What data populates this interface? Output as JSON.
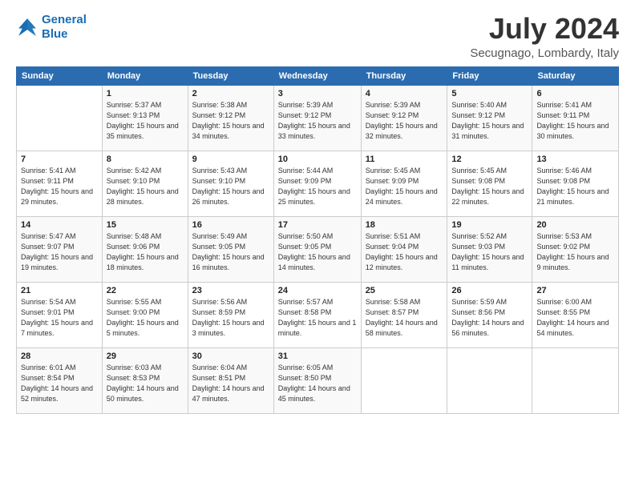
{
  "header": {
    "logo_line1": "General",
    "logo_line2": "Blue",
    "month": "July 2024",
    "location": "Secugnago, Lombardy, Italy"
  },
  "weekdays": [
    "Sunday",
    "Monday",
    "Tuesday",
    "Wednesday",
    "Thursday",
    "Friday",
    "Saturday"
  ],
  "weeks": [
    [
      {
        "day": "",
        "sunrise": "",
        "sunset": "",
        "daylight": ""
      },
      {
        "day": "1",
        "sunrise": "Sunrise: 5:37 AM",
        "sunset": "Sunset: 9:13 PM",
        "daylight": "Daylight: 15 hours and 35 minutes."
      },
      {
        "day": "2",
        "sunrise": "Sunrise: 5:38 AM",
        "sunset": "Sunset: 9:12 PM",
        "daylight": "Daylight: 15 hours and 34 minutes."
      },
      {
        "day": "3",
        "sunrise": "Sunrise: 5:39 AM",
        "sunset": "Sunset: 9:12 PM",
        "daylight": "Daylight: 15 hours and 33 minutes."
      },
      {
        "day": "4",
        "sunrise": "Sunrise: 5:39 AM",
        "sunset": "Sunset: 9:12 PM",
        "daylight": "Daylight: 15 hours and 32 minutes."
      },
      {
        "day": "5",
        "sunrise": "Sunrise: 5:40 AM",
        "sunset": "Sunset: 9:12 PM",
        "daylight": "Daylight: 15 hours and 31 minutes."
      },
      {
        "day": "6",
        "sunrise": "Sunrise: 5:41 AM",
        "sunset": "Sunset: 9:11 PM",
        "daylight": "Daylight: 15 hours and 30 minutes."
      }
    ],
    [
      {
        "day": "7",
        "sunrise": "Sunrise: 5:41 AM",
        "sunset": "Sunset: 9:11 PM",
        "daylight": "Daylight: 15 hours and 29 minutes."
      },
      {
        "day": "8",
        "sunrise": "Sunrise: 5:42 AM",
        "sunset": "Sunset: 9:10 PM",
        "daylight": "Daylight: 15 hours and 28 minutes."
      },
      {
        "day": "9",
        "sunrise": "Sunrise: 5:43 AM",
        "sunset": "Sunset: 9:10 PM",
        "daylight": "Daylight: 15 hours and 26 minutes."
      },
      {
        "day": "10",
        "sunrise": "Sunrise: 5:44 AM",
        "sunset": "Sunset: 9:09 PM",
        "daylight": "Daylight: 15 hours and 25 minutes."
      },
      {
        "day": "11",
        "sunrise": "Sunrise: 5:45 AM",
        "sunset": "Sunset: 9:09 PM",
        "daylight": "Daylight: 15 hours and 24 minutes."
      },
      {
        "day": "12",
        "sunrise": "Sunrise: 5:45 AM",
        "sunset": "Sunset: 9:08 PM",
        "daylight": "Daylight: 15 hours and 22 minutes."
      },
      {
        "day": "13",
        "sunrise": "Sunrise: 5:46 AM",
        "sunset": "Sunset: 9:08 PM",
        "daylight": "Daylight: 15 hours and 21 minutes."
      }
    ],
    [
      {
        "day": "14",
        "sunrise": "Sunrise: 5:47 AM",
        "sunset": "Sunset: 9:07 PM",
        "daylight": "Daylight: 15 hours and 19 minutes."
      },
      {
        "day": "15",
        "sunrise": "Sunrise: 5:48 AM",
        "sunset": "Sunset: 9:06 PM",
        "daylight": "Daylight: 15 hours and 18 minutes."
      },
      {
        "day": "16",
        "sunrise": "Sunrise: 5:49 AM",
        "sunset": "Sunset: 9:05 PM",
        "daylight": "Daylight: 15 hours and 16 minutes."
      },
      {
        "day": "17",
        "sunrise": "Sunrise: 5:50 AM",
        "sunset": "Sunset: 9:05 PM",
        "daylight": "Daylight: 15 hours and 14 minutes."
      },
      {
        "day": "18",
        "sunrise": "Sunrise: 5:51 AM",
        "sunset": "Sunset: 9:04 PM",
        "daylight": "Daylight: 15 hours and 12 minutes."
      },
      {
        "day": "19",
        "sunrise": "Sunrise: 5:52 AM",
        "sunset": "Sunset: 9:03 PM",
        "daylight": "Daylight: 15 hours and 11 minutes."
      },
      {
        "day": "20",
        "sunrise": "Sunrise: 5:53 AM",
        "sunset": "Sunset: 9:02 PM",
        "daylight": "Daylight: 15 hours and 9 minutes."
      }
    ],
    [
      {
        "day": "21",
        "sunrise": "Sunrise: 5:54 AM",
        "sunset": "Sunset: 9:01 PM",
        "daylight": "Daylight: 15 hours and 7 minutes."
      },
      {
        "day": "22",
        "sunrise": "Sunrise: 5:55 AM",
        "sunset": "Sunset: 9:00 PM",
        "daylight": "Daylight: 15 hours and 5 minutes."
      },
      {
        "day": "23",
        "sunrise": "Sunrise: 5:56 AM",
        "sunset": "Sunset: 8:59 PM",
        "daylight": "Daylight: 15 hours and 3 minutes."
      },
      {
        "day": "24",
        "sunrise": "Sunrise: 5:57 AM",
        "sunset": "Sunset: 8:58 PM",
        "daylight": "Daylight: 15 hours and 1 minute."
      },
      {
        "day": "25",
        "sunrise": "Sunrise: 5:58 AM",
        "sunset": "Sunset: 8:57 PM",
        "daylight": "Daylight: 14 hours and 58 minutes."
      },
      {
        "day": "26",
        "sunrise": "Sunrise: 5:59 AM",
        "sunset": "Sunset: 8:56 PM",
        "daylight": "Daylight: 14 hours and 56 minutes."
      },
      {
        "day": "27",
        "sunrise": "Sunrise: 6:00 AM",
        "sunset": "Sunset: 8:55 PM",
        "daylight": "Daylight: 14 hours and 54 minutes."
      }
    ],
    [
      {
        "day": "28",
        "sunrise": "Sunrise: 6:01 AM",
        "sunset": "Sunset: 8:54 PM",
        "daylight": "Daylight: 14 hours and 52 minutes."
      },
      {
        "day": "29",
        "sunrise": "Sunrise: 6:03 AM",
        "sunset": "Sunset: 8:53 PM",
        "daylight": "Daylight: 14 hours and 50 minutes."
      },
      {
        "day": "30",
        "sunrise": "Sunrise: 6:04 AM",
        "sunset": "Sunset: 8:51 PM",
        "daylight": "Daylight: 14 hours and 47 minutes."
      },
      {
        "day": "31",
        "sunrise": "Sunrise: 6:05 AM",
        "sunset": "Sunset: 8:50 PM",
        "daylight": "Daylight: 14 hours and 45 minutes."
      },
      {
        "day": "",
        "sunrise": "",
        "sunset": "",
        "daylight": ""
      },
      {
        "day": "",
        "sunrise": "",
        "sunset": "",
        "daylight": ""
      },
      {
        "day": "",
        "sunrise": "",
        "sunset": "",
        "daylight": ""
      }
    ]
  ]
}
